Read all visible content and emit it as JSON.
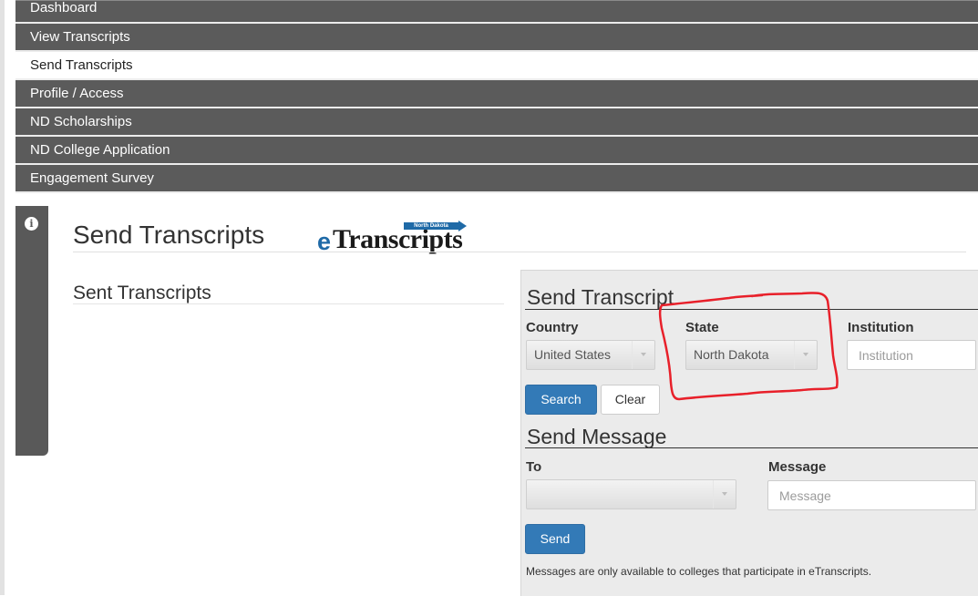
{
  "nav": {
    "items": [
      {
        "label": "Dashboard",
        "active": false
      },
      {
        "label": "View Transcripts",
        "active": false
      },
      {
        "label": "Send Transcripts",
        "active": true
      },
      {
        "label": "Profile / Access",
        "active": false
      },
      {
        "label": "ND Scholarships",
        "active": false
      },
      {
        "label": "ND College Application",
        "active": false
      },
      {
        "label": "Engagement Survey",
        "active": false
      }
    ]
  },
  "side_tab": {
    "icon": "info-icon"
  },
  "page": {
    "title": "Send Transcripts",
    "logo": {
      "prefix": "e",
      "word": "Transcripts",
      "tagline": "North Dakota"
    }
  },
  "sent_transcripts": {
    "heading": "Sent Transcripts"
  },
  "send_transcript": {
    "heading": "Send Transcript",
    "country": {
      "label": "Country",
      "value": "United States"
    },
    "state": {
      "label": "State",
      "value": "North Dakota"
    },
    "institution": {
      "label": "Institution",
      "placeholder": "Institution"
    },
    "search_label": "Search",
    "clear_label": "Clear"
  },
  "send_message": {
    "heading": "Send Message",
    "to": {
      "label": "To",
      "value": ""
    },
    "message": {
      "label": "Message",
      "placeholder": "Message"
    },
    "send_label": "Send",
    "help_text": "Messages are only available to colleges that participate in eTranscripts."
  },
  "annotation": {
    "color": "#e8202a"
  },
  "colors": {
    "nav_bg": "#5b5b5b",
    "primary": "#337ab7",
    "panel_bg": "#ebebeb"
  }
}
